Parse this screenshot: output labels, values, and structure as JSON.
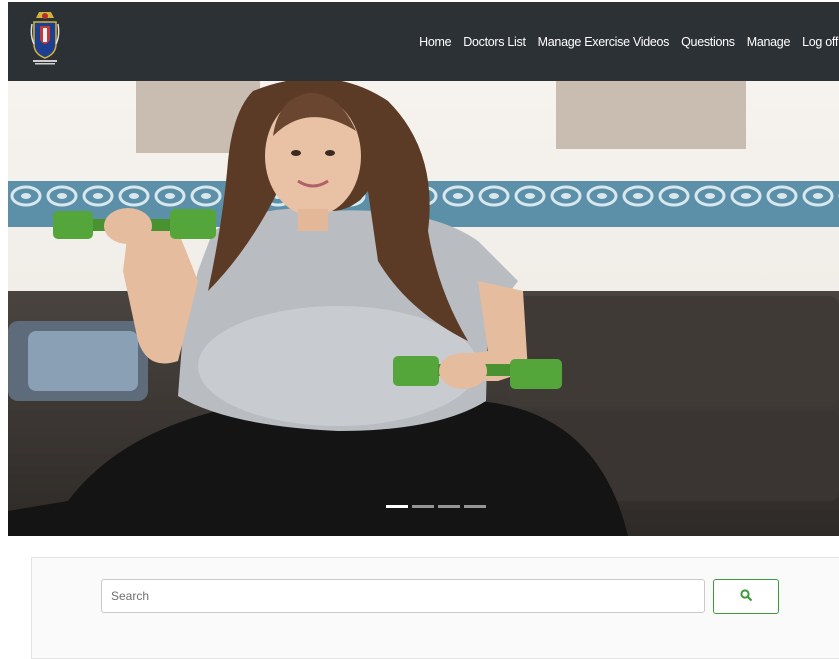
{
  "nav": {
    "items": [
      {
        "label": "Home"
      },
      {
        "label": "Doctors List"
      },
      {
        "label": "Manage Exercise Videos"
      },
      {
        "label": "Questions"
      },
      {
        "label": "Manage"
      },
      {
        "label": "Log off"
      }
    ]
  },
  "hero": {
    "slide_count": 4,
    "active_slide": 1
  },
  "search": {
    "placeholder": "Search",
    "value": "",
    "button_icon": "search-icon"
  },
  "colors": {
    "navbar": "#2c3136",
    "accent_green": "#3c9a3c",
    "dumbbell": "#55a63a",
    "ball": "#3b5fb8"
  }
}
